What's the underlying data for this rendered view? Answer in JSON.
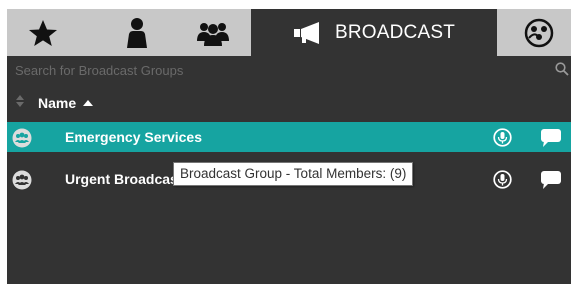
{
  "tabs": [
    {
      "icon": "star-icon"
    },
    {
      "icon": "person-icon"
    },
    {
      "icon": "group-icon"
    },
    {
      "icon": "megaphone-icon",
      "label": "BROADCAST"
    },
    {
      "icon": "conference-icon"
    }
  ],
  "search": {
    "placeholder": "Search for Broadcast Groups"
  },
  "list_header": {
    "name_label": "Name"
  },
  "rows": [
    {
      "name": "Emergency Services",
      "selected": true
    },
    {
      "name": "Urgent Broadcast",
      "selected": false
    }
  ],
  "tooltip": {
    "text": "Broadcast Group - Total Members: (9)"
  },
  "colors": {
    "panel_bg": "#333333",
    "tab_bar_bg": "#c8c8c8",
    "selected_row": "#16a4a1",
    "text": "#ffffff"
  }
}
